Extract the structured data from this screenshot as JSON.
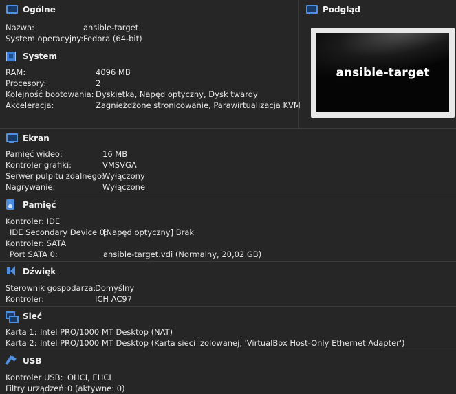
{
  "general": {
    "title": "Ogólne",
    "rows": [
      {
        "key": "Nazwa:",
        "value": "ansible-target"
      },
      {
        "key": "System operacyjny:",
        "value": "Fedora (64-bit)"
      }
    ]
  },
  "preview": {
    "title": "Podgląd",
    "vm_name": "ansible-target"
  },
  "system": {
    "title": "System",
    "rows": [
      {
        "key": "RAM:",
        "value": "4096 MB"
      },
      {
        "key": "Procesory:",
        "value": "2"
      },
      {
        "key": "Kolejność bootowania:",
        "value": "Dyskietka, Napęd optyczny, Dysk twardy"
      },
      {
        "key": "Akceleracja:",
        "value": "Zagnieżdżone stronicowanie, Parawirtualizacja KVM"
      }
    ]
  },
  "display": {
    "title": "Ekran",
    "rows": [
      {
        "key": "Pamięć wideo:",
        "value": "16 MB"
      },
      {
        "key": "Kontroler grafiki:",
        "value": "VMSVGA"
      },
      {
        "key": "Serwer pulpitu zdalnego:",
        "value": "Wyłączony"
      },
      {
        "key": "Nagrywanie:",
        "value": "Wyłączone"
      }
    ]
  },
  "storage": {
    "title": "Pamięć",
    "rows": [
      {
        "key": "Kontroler: IDE",
        "value": ""
      },
      {
        "key": " IDE Secondary Device 0:",
        "value": "[Napęd optyczny] Brak"
      },
      {
        "key": "Kontroler: SATA",
        "value": ""
      },
      {
        "key": " Port SATA 0:",
        "value": "ansible-target.vdi (Normalny, 20,02 GB)"
      }
    ]
  },
  "audio": {
    "title": "Dźwięk",
    "rows": [
      {
        "key": "Sterownik gospodarza:",
        "value": "Domyślny"
      },
      {
        "key": "Kontroler:",
        "value": "ICH AC97"
      }
    ]
  },
  "network": {
    "title": "Sieć",
    "rows": [
      {
        "key": "Karta 1:",
        "value": "Intel PRO/1000 MT Desktop (NAT)"
      },
      {
        "key": "Karta 2:",
        "value": "Intel PRO/1000 MT Desktop (Karta sieci izolowanej, 'VirtualBox Host-Only Ethernet Adapter')"
      }
    ]
  },
  "usb": {
    "title": "USB",
    "rows": [
      {
        "key": "Kontroler USB:",
        "value": "OHCI, EHCI"
      },
      {
        "key": "Filtry urządzeń:",
        "value": "0 (aktywne: 0)"
      }
    ]
  }
}
